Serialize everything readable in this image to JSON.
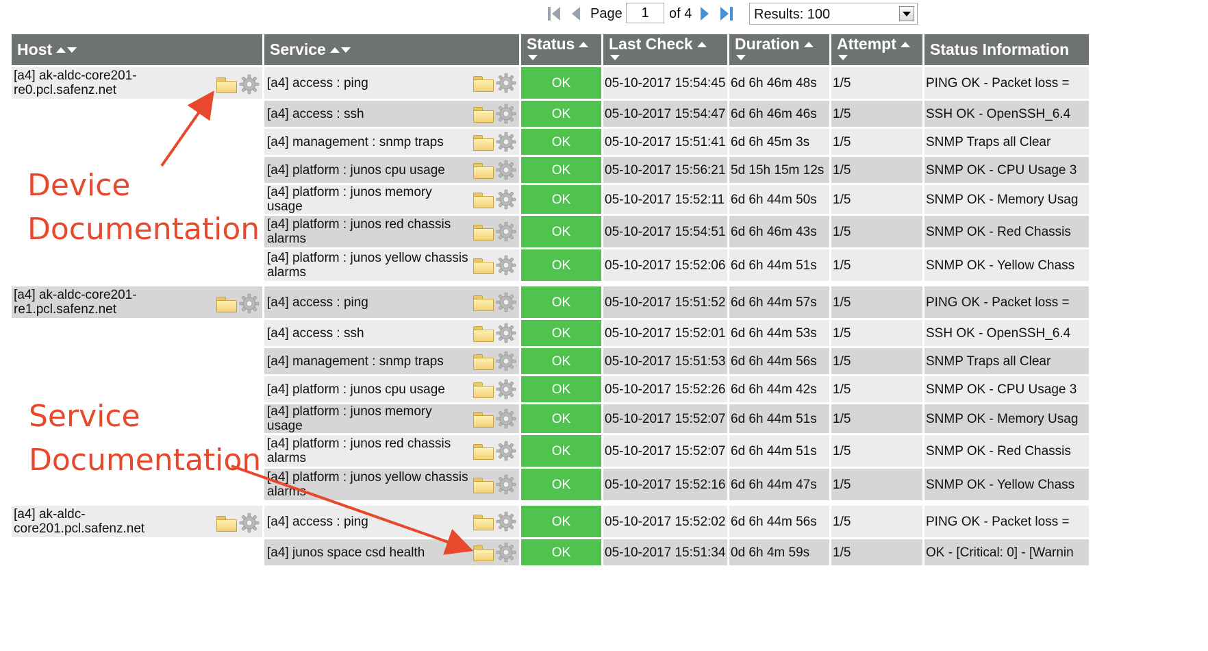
{
  "pager": {
    "page_label": "Page",
    "page_value": "1",
    "of_label": "of 4",
    "results_label": "Results: 100",
    "icons": [
      "first-page-icon",
      "prev-page-icon",
      "next-page-icon",
      "last-page-icon",
      "dropdown-icon"
    ]
  },
  "columns": {
    "host": "Host",
    "service": "Service",
    "status": "Status",
    "last_check": "Last Check",
    "duration": "Duration",
    "attempt": "Attempt",
    "status_info": "Status Information"
  },
  "rows": [
    {
      "host": "[a4] ak-aldc-core201-re0.pcl.safenz.net",
      "service": "[a4] access : ping",
      "status": "OK",
      "last_check": "05-10-2017 15:54:45",
      "duration": "6d 6h 46m 48s",
      "attempt": "1/5",
      "info": "PING OK - Packet loss ="
    },
    {
      "host": "",
      "service": "[a4] access : ssh",
      "status": "OK",
      "last_check": "05-10-2017 15:54:47",
      "duration": "6d 6h 46m 46s",
      "attempt": "1/5",
      "info": "SSH OK - OpenSSH_6.4"
    },
    {
      "host": "",
      "service": "[a4] management : snmp traps",
      "status": "OK",
      "last_check": "05-10-2017 15:51:41",
      "duration": "6d 6h 45m 3s",
      "attempt": "1/5",
      "info": "SNMP Traps all Clear"
    },
    {
      "host": "",
      "service": "[a4] platform : junos cpu usage",
      "status": "OK",
      "last_check": "05-10-2017 15:56:21",
      "duration": "5d 15h 15m 12s",
      "attempt": "1/5",
      "info": "SNMP OK - CPU Usage 3"
    },
    {
      "host": "",
      "service": "[a4] platform : junos memory usage",
      "status": "OK",
      "last_check": "05-10-2017 15:52:11",
      "duration": "6d 6h 44m 50s",
      "attempt": "1/5",
      "info": "SNMP OK - Memory Usag"
    },
    {
      "host": "",
      "service": "[a4] platform : junos red chassis alarms",
      "status": "OK",
      "last_check": "05-10-2017 15:54:51",
      "duration": "6d 6h 46m 43s",
      "attempt": "1/5",
      "info": "SNMP OK - Red Chassis"
    },
    {
      "host": "",
      "service": "[a4] platform : junos yellow chassis alarms",
      "status": "OK",
      "last_check": "05-10-2017 15:52:06",
      "duration": "6d 6h 44m 51s",
      "attempt": "1/5",
      "info": "SNMP OK - Yellow Chass"
    },
    {
      "host": "[a4] ak-aldc-core201-re1.pcl.safenz.net",
      "service": "[a4] access : ping",
      "status": "OK",
      "last_check": "05-10-2017 15:51:52",
      "duration": "6d 6h 44m 57s",
      "attempt": "1/5",
      "info": "PING OK - Packet loss ="
    },
    {
      "host": "",
      "service": "[a4] access : ssh",
      "status": "OK",
      "last_check": "05-10-2017 15:52:01",
      "duration": "6d 6h 44m 53s",
      "attempt": "1/5",
      "info": "SSH OK - OpenSSH_6.4"
    },
    {
      "host": "",
      "service": "[a4] management : snmp traps",
      "status": "OK",
      "last_check": "05-10-2017 15:51:53",
      "duration": "6d 6h 44m 56s",
      "attempt": "1/5",
      "info": "SNMP Traps all Clear"
    },
    {
      "host": "",
      "service": "[a4] platform : junos cpu usage",
      "status": "OK",
      "last_check": "05-10-2017 15:52:26",
      "duration": "6d 6h 44m 42s",
      "attempt": "1/5",
      "info": "SNMP OK - CPU Usage 3"
    },
    {
      "host": "",
      "service": "[a4] platform : junos memory usage",
      "status": "OK",
      "last_check": "05-10-2017 15:52:07",
      "duration": "6d 6h 44m 51s",
      "attempt": "1/5",
      "info": "SNMP OK - Memory Usag"
    },
    {
      "host": "",
      "service": "[a4] platform : junos red chassis alarms",
      "status": "OK",
      "last_check": "05-10-2017 15:52:07",
      "duration": "6d 6h 44m 51s",
      "attempt": "1/5",
      "info": "SNMP OK - Red Chassis"
    },
    {
      "host": "",
      "service": "[a4] platform : junos yellow chassis alarms",
      "status": "OK",
      "last_check": "05-10-2017 15:52:16",
      "duration": "6d 6h 44m 47s",
      "attempt": "1/5",
      "info": "SNMP OK - Yellow Chass"
    },
    {
      "host": "[a4] ak-aldc-core201.pcl.safenz.net",
      "service": "[a4] access : ping",
      "status": "OK",
      "last_check": "05-10-2017 15:52:02",
      "duration": "6d 6h 44m 56s",
      "attempt": "1/5",
      "info": "PING OK - Packet loss ="
    },
    {
      "host": "",
      "service": "[a4] junos space csd health",
      "status": "OK",
      "last_check": "05-10-2017 15:51:34",
      "duration": "0d 6h 4m 59s",
      "attempt": "1/5",
      "info": "OK - [Critical: 0] - [Warnin"
    }
  ],
  "annotations": {
    "device": [
      "Device",
      "Documentation"
    ],
    "service": [
      "Service",
      "Documentation"
    ]
  },
  "colors": {
    "header_bg": "#6f7370",
    "ok_green": "#4fc34d",
    "row_light": "#ececec",
    "row_dark": "#d6d6d6",
    "annotation_red": "#e8482c"
  }
}
